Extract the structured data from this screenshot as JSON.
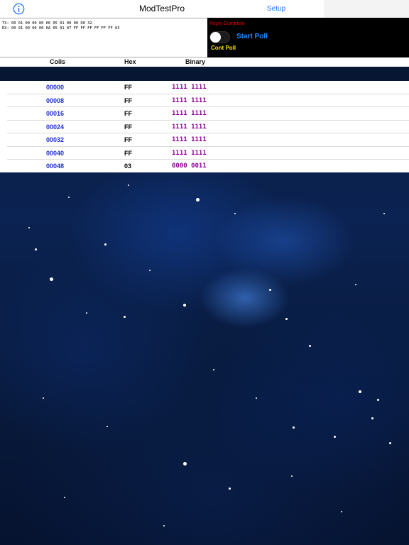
{
  "app": {
    "title": "ModTestPro",
    "setup_label": "Setup",
    "info_icon": "info-circle-icon"
  },
  "log": {
    "tx": "TX: 00 01 00 00 00 06 05 01 00 00 00 32",
    "rx": "RX: 00 01 00 00 00 0A 05 01 07 FF FF FF FF FF FF 03"
  },
  "controls": {
    "status": "Reply Complete",
    "start_poll_label": "Start Poll",
    "cont_poll_label": "Cont Poll",
    "cont_poll_enabled": false
  },
  "table": {
    "headers": {
      "coils": "Coils",
      "hex": "Hex",
      "binary": "Binary"
    },
    "rows": [
      {
        "coil": "00000",
        "hex": "FF",
        "binary": "1111 1111"
      },
      {
        "coil": "00008",
        "hex": "FF",
        "binary": "1111 1111"
      },
      {
        "coil": "00016",
        "hex": "FF",
        "binary": "1111 1111"
      },
      {
        "coil": "00024",
        "hex": "FF",
        "binary": "1111 1111"
      },
      {
        "coil": "00032",
        "hex": "FF",
        "binary": "1111 1111"
      },
      {
        "coil": "00040",
        "hex": "FF",
        "binary": "1111 1111"
      },
      {
        "coil": "00048",
        "hex": "03",
        "binary": "0000 0011"
      }
    ]
  },
  "colors": {
    "accent": "#1a73ff",
    "status_red": "#e00000",
    "cont_poll_yellow": "#f5e000",
    "coil_blue": "#1f2fd0",
    "binary_purple": "#8a0090"
  }
}
